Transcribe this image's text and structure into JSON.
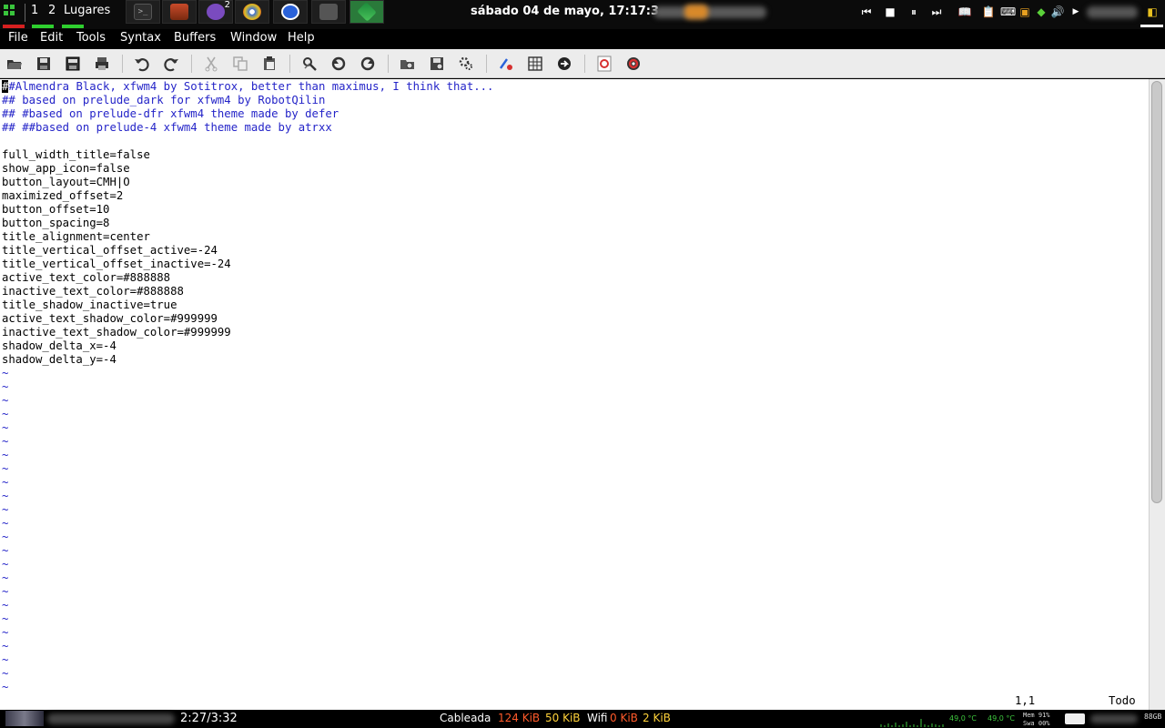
{
  "top_panel": {
    "workspaces": [
      "1",
      "2"
    ],
    "places_label": "Lugares",
    "taskbar_badge": "2",
    "clock": "sábado 04 de mayo, 17:17:3"
  },
  "menubar": {
    "items": [
      "File",
      "Edit",
      "Tools",
      "Syntax",
      "Buffers",
      "Window",
      "Help"
    ]
  },
  "toolbar": {
    "icons": [
      "open-icon",
      "save-icon",
      "save-all-icon",
      "print-icon",
      "undo-icon",
      "redo-icon",
      "cut-icon",
      "copy-icon",
      "paste-icon",
      "find-replace-icon",
      "find-next-icon",
      "find-prev-icon",
      "load-session-icon",
      "save-session-icon",
      "run-script-icon",
      "make-icon",
      "shell-icon",
      "tags-icon",
      "help-icon",
      "find-help-icon"
    ]
  },
  "editor": {
    "cursor_char": "#",
    "first_line_rest": "#Almendra Black, xfwm4 by Sotitrox, better than maximus, I think that...",
    "comment_lines": [
      "## based on prelude_dark for xfwm4 by RobotQilin",
      "## #based on prelude-dfr xfwm4 theme made by defer",
      "## ##based on prelude-4 xfwm4 theme made by atrxx"
    ],
    "config_lines": [
      "full_width_title=false",
      "show_app_icon=false",
      "button_layout=CMH|O",
      "maximized_offset=2",
      "button_offset=10",
      "button_spacing=8",
      "title_alignment=center",
      "title_vertical_offset_active=-24",
      "title_vertical_offset_inactive=-24",
      "active_text_color=#888888",
      "inactive_text_color=#888888",
      "title_shadow_inactive=true",
      "active_text_shadow_color=#999999",
      "inactive_text_shadow_color=#999999",
      "shadow_delta_x=-4",
      "shadow_delta_y=-4"
    ],
    "empty_line_marker": "~",
    "empty_line_count": 24,
    "ruler_position": "1,1",
    "ruler_scope": "Todo"
  },
  "bottom_panel": {
    "media_time": "2:27/3:32",
    "net_wired_label": "Cableada",
    "net_wired_down": "124 KiB",
    "net_wired_up": "50 KiB",
    "net_wifi_label": "Wifi",
    "net_wifi_down": "0 KiB",
    "net_wifi_up": "2 KiB",
    "temp1": "49,0 °C",
    "temp2": "49,0 °C",
    "mem_label": "Mem 91%",
    "swap_label": "Swa 00%",
    "disk_label": "88GB"
  },
  "colors": {
    "comment": "#2424c8",
    "net_down": "#ff5a2a",
    "net_up": "#ffd23a",
    "temp": "#3ec83e",
    "ws_active": "#d62020",
    "ws_inactive": "#2fcf2f"
  }
}
